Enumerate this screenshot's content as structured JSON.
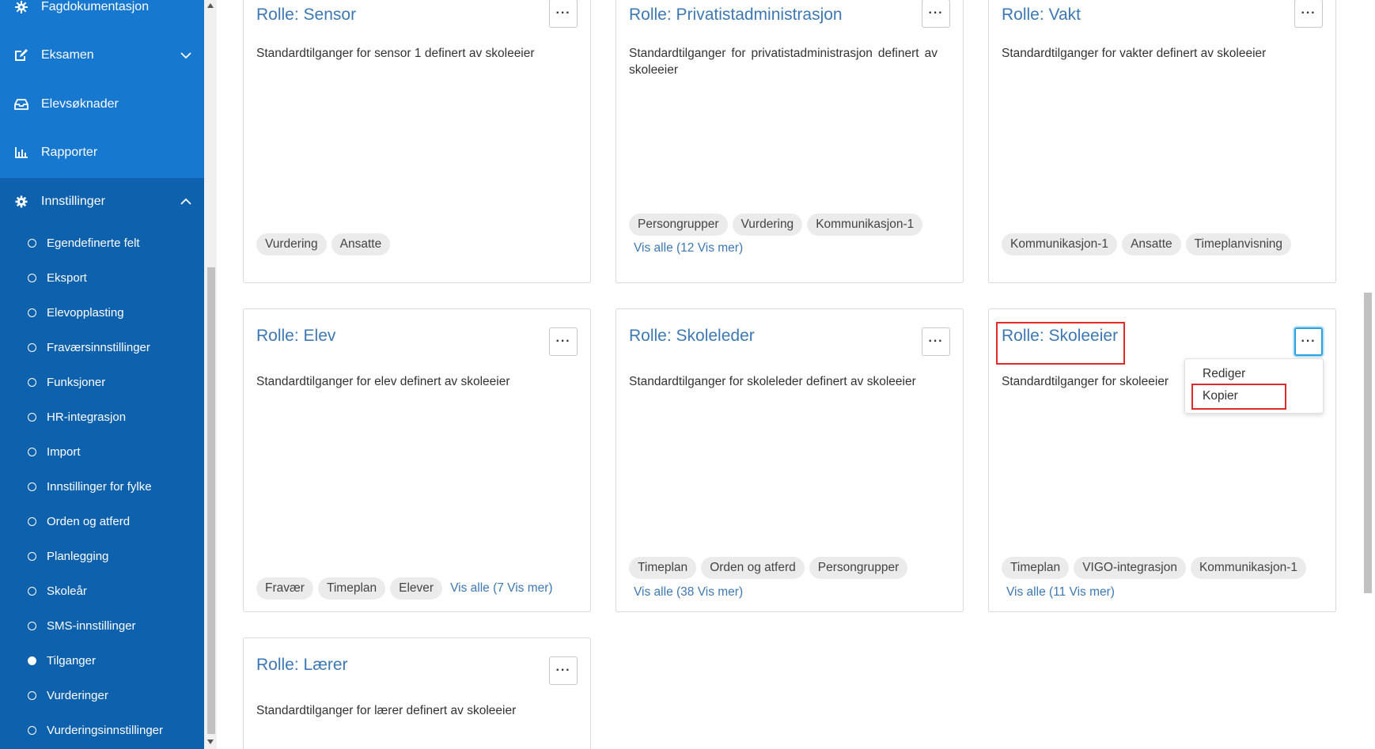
{
  "sidebar": {
    "items": [
      {
        "label": "Fagdokumentasjon",
        "icon": "gear-icon"
      },
      {
        "label": "Eksamen",
        "icon": "pen-icon"
      },
      {
        "label": "Elevsøknader",
        "icon": "inbox-icon"
      },
      {
        "label": "Rapporter",
        "icon": "bar-chart-icon"
      },
      {
        "label": "Innstillinger",
        "icon": "settings-gear-icon"
      }
    ],
    "settings_items": [
      "Egendefinerte felt",
      "Eksport",
      "Elevopplasting",
      "Fraværsinnstillinger",
      "Funksjoner",
      "HR-integrasjon",
      "Import",
      "Innstillinger for fylke",
      "Orden og atferd",
      "Planlegging",
      "Skoleår",
      "SMS-innstillinger",
      "Tilganger",
      "Vurderinger",
      "Vurderingsinnstillinger"
    ],
    "active_settings_item": "Tilganger"
  },
  "cards": [
    {
      "title": "Rolle: Sensor",
      "desc": "Standardtilganger for sensor 1 definert av skoleeier",
      "tags": [
        "Vurdering",
        "Ansatte"
      ],
      "link": ""
    },
    {
      "title": "Rolle: Privatistadministrasjon",
      "desc": "Standardtilganger for privatistadministrasjon definert av skoleeier",
      "tags": [
        "Persongrupper",
        "Vurdering",
        "Kommunikasjon-1"
      ],
      "link": "Vis alle (12 Vis mer)"
    },
    {
      "title": "Rolle: Vakt",
      "desc": "Standardtilganger for vakter definert av skoleeier",
      "tags": [
        "Kommunikasjon-1",
        "Ansatte",
        "Timeplanvisning"
      ],
      "link": ""
    },
    {
      "title": "Rolle: Elev",
      "desc": "Standardtilganger for elev definert av skoleeier",
      "tags": [
        "Fravær",
        "Timeplan",
        "Elever"
      ],
      "link": "Vis alle (7 Vis mer)"
    },
    {
      "title": "Rolle: Skoleleder",
      "desc": "Standardtilganger for skoleleder definert av skoleeier",
      "tags": [
        "Timeplan",
        "Orden og atferd",
        "Persongrupper"
      ],
      "link": "Vis alle (38 Vis mer)"
    },
    {
      "title": "Rolle: Skoleeier",
      "desc": "Standardtilganger for skoleeier",
      "tags": [
        "Timeplan",
        "VIGO-integrasjon",
        "Kommunikasjon-1"
      ],
      "link": "Vis alle (11 Vis mer)"
    },
    {
      "title": "Rolle: Lærer",
      "desc": "Standardtilganger for lærer definert av skoleeier",
      "tags": [],
      "link": ""
    }
  ],
  "more_button_label": "···",
  "context_menu": {
    "items": [
      "Rediger",
      "Kopier"
    ]
  }
}
